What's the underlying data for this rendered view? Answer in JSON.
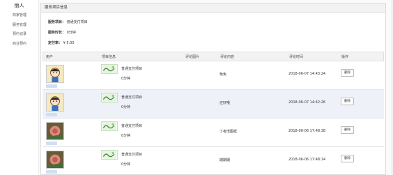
{
  "sidebar": {
    "brand": "丽人",
    "items": [
      {
        "label": "商家管理"
      },
      {
        "label": "服务管理"
      },
      {
        "label": "预约记录"
      },
      {
        "label": "商业预约"
      }
    ]
  },
  "panel": {
    "title": "服务项目信息",
    "info": {
      "name_label": "服务项目：",
      "name_value": "普通支付项目",
      "duration_label": "服务时长：",
      "duration_value": "0分钟",
      "deposit_label": "定付率：",
      "deposit_value": "¥ 5.00"
    }
  },
  "table": {
    "headers": {
      "user": "用户",
      "project": "项目信息",
      "images": "评论图片",
      "content": "评论内容",
      "time": "评论时间",
      "action": "操作"
    },
    "rows": [
      {
        "project_name": "普通支付项目",
        "project_duration": "0分钟",
        "content": "免免",
        "time": "2018-06-07 14:43:24",
        "delete_label": "删除",
        "avatar": "cartoon"
      },
      {
        "project_name": "普通支付项目",
        "project_duration": "0分钟",
        "content": "还好哦",
        "time": "2018-06-07 14:42:26",
        "delete_label": "删除",
        "avatar": "cartoon"
      },
      {
        "project_name": "普通支付项目",
        "project_duration": "0分钟",
        "content": "了考虑图纸",
        "time": "2018-06-06 17:48:38",
        "delete_label": "删除",
        "avatar": "flower"
      },
      {
        "project_name": "普通支付项目",
        "project_duration": "0分钟",
        "content": "期期期",
        "time": "2018-06-06 17:48:14",
        "delete_label": "删除",
        "avatar": "flower"
      }
    ]
  }
}
